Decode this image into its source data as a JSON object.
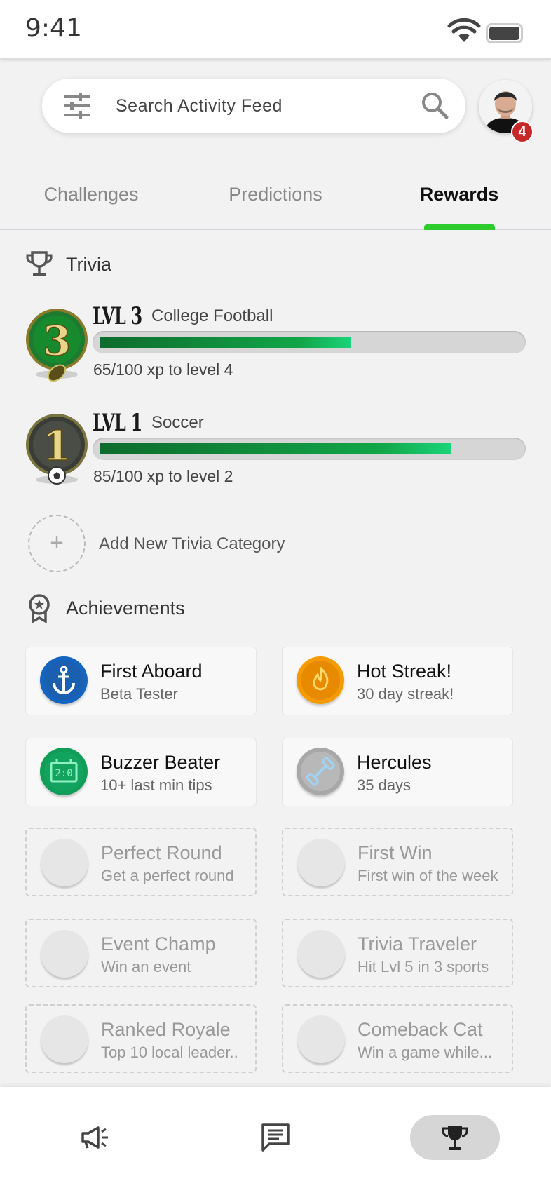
{
  "status_bar": {
    "time": "9:41"
  },
  "search": {
    "placeholder": "Search Activity Feed"
  },
  "profile": {
    "notification_count": "4"
  },
  "tabs": [
    {
      "label": "Challenges"
    },
    {
      "label": "Predictions"
    },
    {
      "label": "Rewards"
    }
  ],
  "trivia": {
    "title": "Trivia",
    "levels": [
      {
        "badge_number": "3",
        "level": "LVL 3",
        "category": "College Football",
        "progress": 0.6,
        "xp_text": "65/100 xp to level 4"
      },
      {
        "badge_number": "1",
        "level": "LVL 1",
        "category": "Soccer",
        "progress": 0.84,
        "xp_text": "85/100 xp to level 2"
      }
    ],
    "add_label": "Add New Trivia Category"
  },
  "achievements": {
    "title": "Achievements",
    "items": [
      {
        "title": "First Aboard",
        "subtitle": "Beta Tester",
        "icon": "anchor-icon",
        "color": "#1565c0"
      },
      {
        "title": "Hot Streak!",
        "subtitle": "30 day streak!",
        "icon": "flame-icon",
        "color": "#f59b00"
      },
      {
        "title": "Buzzer Beater",
        "subtitle": "10+ last min tips",
        "icon": "scoreboard-icon",
        "color": "#0f9d58"
      },
      {
        "title": "Hercules",
        "subtitle": "35 days",
        "icon": "dumbbell-icon",
        "color": "#9e9e9e"
      },
      {
        "title": "Perfect Round",
        "subtitle": "Get a perfect round"
      },
      {
        "title": "First Win",
        "subtitle": "First win of the week"
      },
      {
        "title": "Event Champ",
        "subtitle": "Win an event"
      },
      {
        "title": "Trivia Traveler",
        "subtitle": "Hit Lvl 5 in 3 sports"
      },
      {
        "title": "Ranked Royale",
        "subtitle": "Top 10 local leader.."
      },
      {
        "title": "Comeback Cat",
        "subtitle": "Win a game while..."
      }
    ]
  },
  "bottom_nav": [
    {
      "icon": "megaphone-icon"
    },
    {
      "icon": "chat-icon"
    },
    {
      "icon": "trophy-icon",
      "active": true
    }
  ],
  "colors": {
    "accent": "#2ccc2c",
    "progress": "#11a648",
    "badge": "#c62828"
  }
}
